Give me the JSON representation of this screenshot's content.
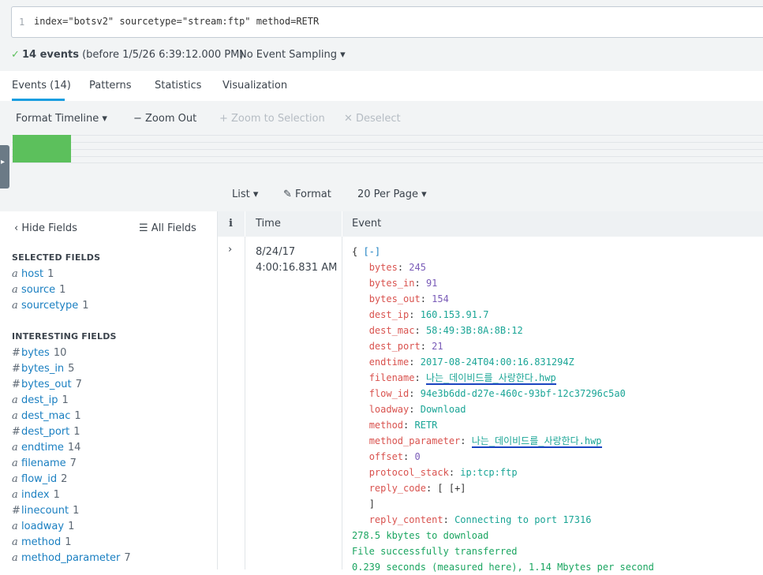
{
  "search": {
    "line_number": "1",
    "query": "index=\"botsv2\" sourcetype=\"stream:ftp\" method=RETR"
  },
  "status": {
    "check_icon": "checkmark-icon",
    "count": "14 events",
    "before": "(before 1/5/26 6:39:12.000 PM)",
    "sampling": "No Event Sampling ▾"
  },
  "tabs": [
    {
      "label": "Events (14)",
      "active": true
    },
    {
      "label": "Patterns"
    },
    {
      "label": "Statistics"
    },
    {
      "label": "Visualization"
    }
  ],
  "timeline": {
    "format": "Format Timeline ▾",
    "zoom_out": "− Zoom Out",
    "zoom_selection": "+ Zoom to Selection",
    "deselect": "✕ Deselect"
  },
  "results_toolbar": {
    "list": "List ▾",
    "format": "Format",
    "per_page": "20 Per Page ▾"
  },
  "fields_panel": {
    "hide_fields": "Hide Fields",
    "all_fields": "All Fields",
    "selected_heading": "SELECTED FIELDS",
    "selected": [
      {
        "type": "a",
        "name": "host",
        "count": "1"
      },
      {
        "type": "a",
        "name": "source",
        "count": "1"
      },
      {
        "type": "a",
        "name": "sourcetype",
        "count": "1"
      }
    ],
    "interesting_heading": "INTERESTING FIELDS",
    "interesting": [
      {
        "type": "#",
        "name": "bytes",
        "count": "10"
      },
      {
        "type": "#",
        "name": "bytes_in",
        "count": "5"
      },
      {
        "type": "#",
        "name": "bytes_out",
        "count": "7"
      },
      {
        "type": "a",
        "name": "dest_ip",
        "count": "1"
      },
      {
        "type": "a",
        "name": "dest_mac",
        "count": "1"
      },
      {
        "type": "#",
        "name": "dest_port",
        "count": "1"
      },
      {
        "type": "a",
        "name": "endtime",
        "count": "14"
      },
      {
        "type": "a",
        "name": "filename",
        "count": "7"
      },
      {
        "type": "a",
        "name": "flow_id",
        "count": "2"
      },
      {
        "type": "a",
        "name": "index",
        "count": "1"
      },
      {
        "type": "#",
        "name": "linecount",
        "count": "1"
      },
      {
        "type": "a",
        "name": "loadway",
        "count": "1"
      },
      {
        "type": "a",
        "name": "method",
        "count": "1"
      },
      {
        "type": "a",
        "name": "method_parameter",
        "count": "7"
      }
    ]
  },
  "table": {
    "col_i": "i",
    "col_time": "Time",
    "col_event": "Event"
  },
  "event": {
    "date": "8/24/17",
    "time": "4:00:16.831 AM",
    "open": "{ [-]",
    "fields": [
      {
        "key": "bytes",
        "value": "245",
        "kind": "num"
      },
      {
        "key": "bytes_in",
        "value": "91",
        "kind": "num"
      },
      {
        "key": "bytes_out",
        "value": "154",
        "kind": "num"
      },
      {
        "key": "dest_ip",
        "value": "160.153.91.7",
        "kind": "str"
      },
      {
        "key": "dest_mac",
        "value": "58:49:3B:8A:8B:12",
        "kind": "str"
      },
      {
        "key": "dest_port",
        "value": "21",
        "kind": "num"
      },
      {
        "key": "endtime",
        "value": "2017-08-24T04:00:16.831294Z",
        "kind": "str"
      },
      {
        "key": "filename",
        "value": "나는_데이비드를_사랑한다.hwp",
        "kind": "str",
        "underlined": true
      },
      {
        "key": "flow_id",
        "value": "94e3b6dd-d27e-460c-93bf-12c37296c5a0",
        "kind": "str"
      },
      {
        "key": "loadway",
        "value": "Download",
        "kind": "str"
      },
      {
        "key": "method",
        "value": "RETR",
        "kind": "str"
      },
      {
        "key": "method_parameter",
        "value": "나는_데이비드를_사랑한다.hwp",
        "kind": "str",
        "underlined": true
      },
      {
        "key": "offset",
        "value": "0",
        "kind": "num"
      },
      {
        "key": "protocol_stack",
        "value": "ip:tcp:ftp",
        "kind": "str"
      },
      {
        "key": "reply_code",
        "value": "[ [+]",
        "kind": "punc"
      }
    ],
    "reply_close": "]",
    "reply_content_key": "reply_content",
    "reply_content_value": "Connecting to port 17316",
    "raw_lines": [
      "278.5 kbytes to download",
      "File successfully transferred",
      "0.239 seconds (measured here), 1.14 Mbytes per second"
    ]
  },
  "colors": {
    "accent": "#1a9ee0",
    "timeline_bar": "#5cc05c",
    "key": "#d9534f",
    "value": "#1aa596",
    "number": "#7a5cb8"
  }
}
